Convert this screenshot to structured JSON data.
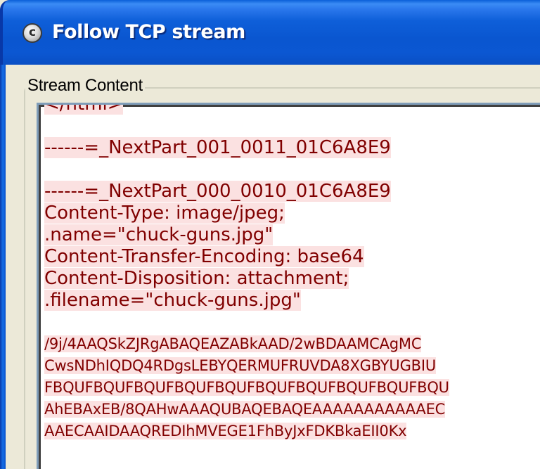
{
  "window": {
    "title": "Follow TCP stream",
    "icon": "wireshark-app-icon",
    "icon_glyph": "c"
  },
  "group": {
    "label": "Stream Content"
  },
  "stream": {
    "lines": [
      "</html>",
      "",
      "------=_NextPart_001_0011_01C6A8E9",
      "",
      "------=_NextPart_000_0010_01C6A8E9",
      "Content-Type: image/jpeg;",
      ".name=\"chuck-guns.jpg\"",
      "Content-Transfer-Encoding: base64",
      "Content-Disposition: attachment;",
      ".filename=\"chuck-guns.jpg\"",
      "",
      "/9j/4AAQSkZJRgABAQEAZABkAAD/2wBDAAMCAgMC",
      "CwsNDhIQDQ4RDgsLEBYQERMUFRUVDA8XGBYUGBIU",
      "FBQUFBQUFBQUFBQUFBQUFBQUFBQUFBQUFBQUFBQU",
      "AhEBAxEB/8QAHwAAAQUBAQEBAQEAAAAAAAAAAAEC",
      "AAECAAIDAAQREDIhMVEGE1FhByJxFDKBkaEII0Kx"
    ],
    "colors": {
      "text": "#800000",
      "highlight": "#fbe1e1"
    }
  }
}
